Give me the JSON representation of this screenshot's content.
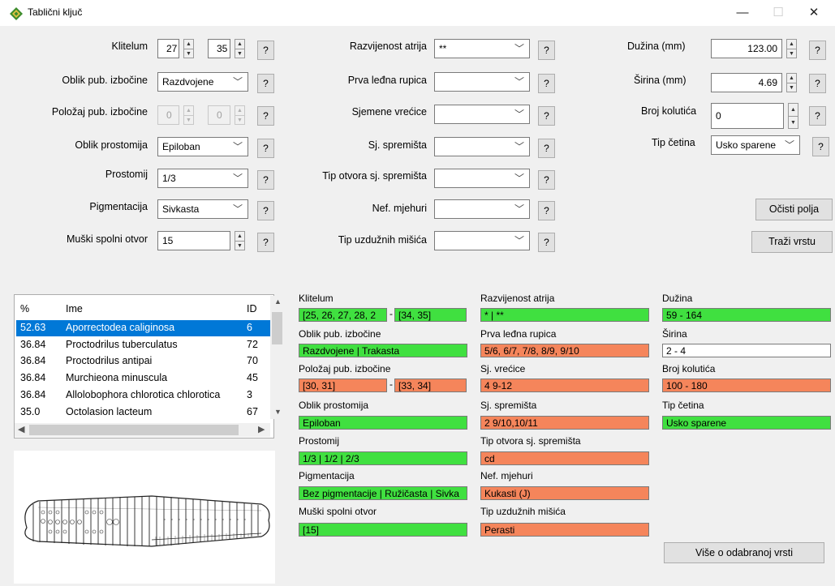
{
  "window": {
    "title": "Tablični ključ",
    "minimize": "—",
    "maximize": "☐",
    "close": "✕"
  },
  "form": {
    "klitelum": {
      "label": "Klitelum",
      "from": "27",
      "to": "35"
    },
    "oblik_pub": {
      "label": "Oblik pub. izbočine",
      "value": "Razdvojene"
    },
    "polozaj_pub": {
      "label": "Položaj pub. izbočine",
      "from": "0",
      "to": "0"
    },
    "oblik_prost": {
      "label": "Oblik prostomija",
      "value": "Epiloban"
    },
    "prostomij": {
      "label": "Prostomij",
      "value": "1/3"
    },
    "pigmentacija": {
      "label": "Pigmentacija",
      "value": "Sivkasta"
    },
    "muski": {
      "label": "Muški spolni otvor",
      "value": "15"
    },
    "atrij": {
      "label": "Razvijenost atrija",
      "value": "**"
    },
    "prva_ledna": {
      "label": "Prva leđna rupica",
      "value": ""
    },
    "sjemene": {
      "label": "Sjemene vrećice",
      "value": ""
    },
    "sj_spremista": {
      "label": "Sj. spremišta",
      "value": ""
    },
    "tip_otvora": {
      "label": "Tip otvora sj. spremišta",
      "value": ""
    },
    "nef": {
      "label": "Nef. mjehuri",
      "value": ""
    },
    "misici": {
      "label": "Tip uzdužnih mišića",
      "value": ""
    },
    "duzina": {
      "label": "Dužina (mm)",
      "value": "123.00"
    },
    "sirina": {
      "label": "Širina (mm)",
      "value": "4.69"
    },
    "kolutici": {
      "label": "Broj kolutića",
      "value": "0"
    },
    "cetine": {
      "label": "Tip četina",
      "value": "Usko sparene"
    },
    "help": "?",
    "clear_label": "Očisti polja",
    "search_label": "Traži vrstu"
  },
  "results_list": {
    "headers": [
      "%",
      "Ime",
      "ID"
    ],
    "rows": [
      {
        "pct": "52.63",
        "name": "Aporrectodea caliginosa",
        "id": "6"
      },
      {
        "pct": "36.84",
        "name": "Proctodrilus tuberculatus",
        "id": "72"
      },
      {
        "pct": "36.84",
        "name": "Proctodrilus antipai",
        "id": "70"
      },
      {
        "pct": "36.84",
        "name": "Murchieona minuscula",
        "id": "45"
      },
      {
        "pct": "36.84",
        "name": "Allolobophora chlorotica chlorotica",
        "id": "3"
      },
      {
        "pct": "35.0",
        "name": "Octolasion lacteum",
        "id": "67"
      }
    ],
    "selected_index": 0
  },
  "details": {
    "klitelum": {
      "label": "Klitelum",
      "from": "[25, 26, 27, 28, 2",
      "sep": "-",
      "to": "[34, 35]"
    },
    "oblik_pub": {
      "label": "Oblik pub. izbočine",
      "value": "Razdvojene | Trakasta"
    },
    "polozaj_pub": {
      "label": "Položaj pub. izbočine",
      "from": "[30, 31]",
      "sep": "-",
      "to": "[33, 34]"
    },
    "oblik_prost": {
      "label": "Oblik prostomija",
      "value": "Epiloban"
    },
    "prostomij": {
      "label": "Prostomij",
      "value": "1/3 | 1/2 | 2/3"
    },
    "pigmentacija": {
      "label": "Pigmentacija",
      "value": "Bez pigmentacije | Ružičasta | Sivka"
    },
    "muski": {
      "label": "Muški spolni otvor",
      "value": "[15]"
    },
    "atrij": {
      "label": "Razvijenost atrija",
      "value": "* | **"
    },
    "prva_ledna": {
      "label": "Prva leđna rupica",
      "value": "5/6, 6/7, 7/8, 8/9, 9/10"
    },
    "sjemene": {
      "label": "Sj. vrećice",
      "value": "4 9-12"
    },
    "sj_spremista": {
      "label": "Sj. spremišta",
      "value": "2 9/10,10/11"
    },
    "tip_otvora": {
      "label": "Tip otvora sj. spremišta",
      "value": "cd"
    },
    "nef": {
      "label": "Nef. mjehuri",
      "value": "Kukasti (J)"
    },
    "misici": {
      "label": "Tip uzdužnih mišića",
      "value": "Perasti"
    },
    "duzina": {
      "label": "Dužina",
      "value": "59 - 164"
    },
    "sirina": {
      "label": "Širina",
      "value": "2 - 4"
    },
    "kolutici": {
      "label": "Broj kolutića",
      "value": "100 - 180"
    },
    "cetine": {
      "label": "Tip četina",
      "value": "Usko sparene"
    },
    "more_label": "Više o odabranoj vrsti"
  },
  "colors": {
    "match": "#40e040",
    "mismatch": "#f5855b",
    "selection": "#0078d7"
  }
}
